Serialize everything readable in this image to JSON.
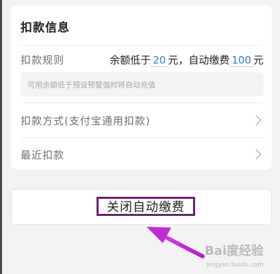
{
  "deduction_info": {
    "title": "扣款信息",
    "rule_label": "扣款规则",
    "rule_value": {
      "prefix": "余额低于",
      "threshold": "20",
      "middle": "元，自动缴费",
      "amount": "100",
      "suffix": "元"
    },
    "hint": "可用余额低于预设预警值时将自动充值",
    "method_label": "扣款方式(支付宝通用扣款)",
    "recent_label": "最近扣款"
  },
  "actions": {
    "close_auto_pay": "关闭自动缴费"
  },
  "watermark": {
    "logo": "Bai度经验",
    "url": "jingyan.baidu.com"
  },
  "colors": {
    "background": "#f3f3f4",
    "card": "#ffffff",
    "accent_number": "#3a78c8",
    "annotation_border": "#6b1f72",
    "annotation_arrow": "#c02bd8"
  }
}
